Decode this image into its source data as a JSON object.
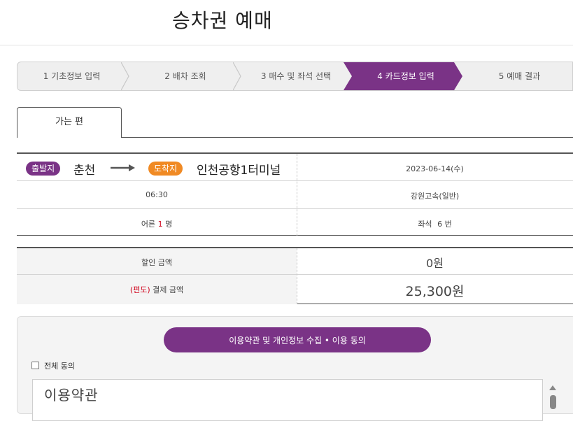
{
  "page": {
    "title": "승차권 예매"
  },
  "steps": [
    {
      "label": "1 기초정보 입력",
      "active": false
    },
    {
      "label": "2 배차 조회",
      "active": false
    },
    {
      "label": "3 매수 및 좌석 선택",
      "active": false
    },
    {
      "label": "4 카드정보 입력",
      "active": true
    },
    {
      "label": "5 예매 결과",
      "active": false
    }
  ],
  "tabs": {
    "outbound": "가는 편"
  },
  "trip": {
    "departure_badge": "출발지",
    "departure": "춘천",
    "arrival_badge": "도착지",
    "arrival": "인천공항1터미널",
    "date": "2023-06-14(수)",
    "time": "06:30",
    "company": "강원고속(일반)",
    "passengers_label": "어른",
    "passengers_count": "1",
    "passengers_unit": "명",
    "seat_label": "좌석",
    "seat_number": "6",
    "seat_unit": "번"
  },
  "price": {
    "discount_label": "할인 금액",
    "discount_value": "0원",
    "payment_prefix": "(편도)",
    "payment_label": "결제 금액",
    "payment_value": "25,300원"
  },
  "agreement": {
    "button_label": "이용약관 및 개인정보 수집 • 이용 동의",
    "all_agree_label": "전체 동의",
    "all_agree_checked": false,
    "terms_title": "이용약관"
  },
  "colors": {
    "accent_purple": "#7a3386",
    "arrival_orange": "#f08a24",
    "highlight_red": "#d0021b"
  }
}
